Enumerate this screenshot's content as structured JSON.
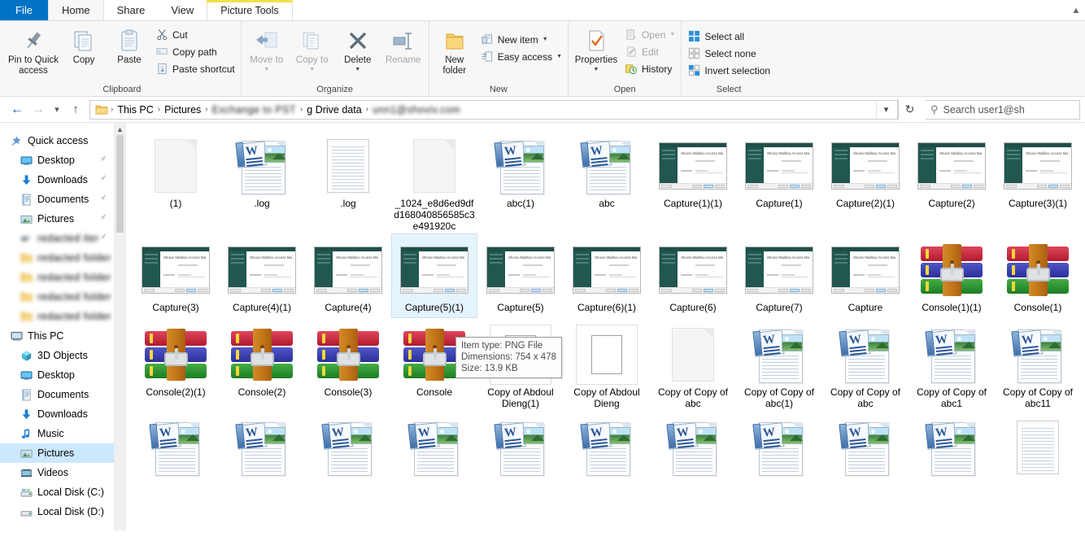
{
  "window": {
    "tabs": [
      {
        "label": "File",
        "kind": "file"
      },
      {
        "label": "Home",
        "kind": "active"
      },
      {
        "label": "Share",
        "kind": "normal"
      },
      {
        "label": "View",
        "kind": "normal"
      },
      {
        "label": "Picture Tools",
        "kind": "contextual"
      }
    ],
    "collapse_icon": "chevron-up"
  },
  "ribbon": {
    "groups": [
      {
        "title": "Clipboard",
        "large": [
          {
            "label": "Pin to Quick access",
            "icon": "pin-icon",
            "disabled": false
          },
          {
            "label": "Copy",
            "icon": "copy-icon",
            "disabled": false
          },
          {
            "label": "Paste",
            "icon": "paste-icon",
            "disabled": false
          }
        ],
        "small": [
          {
            "label": "Cut",
            "icon": "scissors-icon",
            "disabled": false
          },
          {
            "label": "Copy path",
            "icon": "copy-path-icon",
            "disabled": false
          },
          {
            "label": "Paste shortcut",
            "icon": "paste-shortcut-icon",
            "disabled": false
          }
        ]
      },
      {
        "title": "Organize",
        "large": [
          {
            "label": "Move to",
            "icon": "move-to-icon",
            "disabled": true,
            "caret": true
          },
          {
            "label": "Copy to",
            "icon": "copy-to-icon",
            "disabled": true,
            "caret": true
          },
          {
            "label": "Delete",
            "icon": "delete-x-icon",
            "disabled": false,
            "caret": true
          },
          {
            "label": "Rename",
            "icon": "rename-icon",
            "disabled": true
          }
        ]
      },
      {
        "title": "New",
        "large": [
          {
            "label": "New folder",
            "icon": "new-folder-icon",
            "disabled": false
          }
        ],
        "small": [
          {
            "label": "New item",
            "icon": "new-item-icon",
            "disabled": false,
            "caret": true
          },
          {
            "label": "Easy access",
            "icon": "easy-access-icon",
            "disabled": false,
            "caret": true
          }
        ]
      },
      {
        "title": "Open",
        "large": [
          {
            "label": "Properties",
            "icon": "properties-icon",
            "disabled": false,
            "caret": true
          }
        ],
        "small": [
          {
            "label": "Open",
            "icon": "open-icon",
            "disabled": true,
            "caret": true
          },
          {
            "label": "Edit",
            "icon": "edit-icon",
            "disabled": true
          },
          {
            "label": "History",
            "icon": "history-icon",
            "disabled": false
          }
        ]
      },
      {
        "title": "Select",
        "small": [
          {
            "label": "Select all",
            "icon": "select-all-icon",
            "disabled": false
          },
          {
            "label": "Select none",
            "icon": "select-none-icon",
            "disabled": false
          },
          {
            "label": "Invert selection",
            "icon": "invert-selection-icon",
            "disabled": false
          }
        ]
      }
    ]
  },
  "address": {
    "back_icon": "arrow-left-icon",
    "forward_icon": "arrow-right-icon",
    "recent_icon": "chevron-down-icon",
    "up_icon": "arrow-up-icon",
    "folder_icon": "folder-icon",
    "separator": "›",
    "crumbs": [
      {
        "label": "This PC",
        "blurred": false
      },
      {
        "label": "Pictures",
        "blurred": false
      },
      {
        "label": "Exchange to PST",
        "blurred": true
      },
      {
        "label": "g Drive data",
        "blurred": false
      },
      {
        "label": "unn1@shoviv.com",
        "blurred": true
      }
    ],
    "dropdown_icon": "chevron-down-icon",
    "refresh_icon": "refresh-icon"
  },
  "search": {
    "icon": "search-icon",
    "text": "Search user1@sh"
  },
  "sidebar": {
    "scroll_up_icon": "chevron-up-icon",
    "items": [
      {
        "label": "Quick access",
        "icon": "quick-access-star-icon",
        "level": 0,
        "pinned": false,
        "blurred": false,
        "selected": false
      },
      {
        "label": "Desktop",
        "icon": "desktop-icon",
        "level": 1,
        "pinned": true,
        "blurred": false,
        "selected": false
      },
      {
        "label": "Downloads",
        "icon": "downloads-icon",
        "level": 1,
        "pinned": true,
        "blurred": false,
        "selected": false
      },
      {
        "label": "Documents",
        "icon": "documents-icon",
        "level": 1,
        "pinned": true,
        "blurred": false,
        "selected": false
      },
      {
        "label": "Pictures",
        "icon": "pictures-icon",
        "level": 1,
        "pinned": true,
        "blurred": false,
        "selected": false
      },
      {
        "label": "redacted item",
        "icon": "generic-icon",
        "level": 1,
        "pinned": true,
        "blurred": true,
        "selected": false
      },
      {
        "label": "redacted folder one",
        "icon": "folder-icon",
        "level": 1,
        "pinned": false,
        "blurred": true,
        "selected": false
      },
      {
        "label": "redacted folder two",
        "icon": "folder-icon",
        "level": 1,
        "pinned": false,
        "blurred": true,
        "selected": false
      },
      {
        "label": "redacted folder three",
        "icon": "folder-icon",
        "level": 1,
        "pinned": false,
        "blurred": true,
        "selected": false
      },
      {
        "label": "redacted folder four",
        "icon": "folder-icon",
        "level": 1,
        "pinned": false,
        "blurred": true,
        "selected": false
      },
      {
        "label": "This PC",
        "icon": "this-pc-icon",
        "level": 0,
        "pinned": false,
        "blurred": false,
        "selected": false
      },
      {
        "label": "3D Objects",
        "icon": "3d-objects-icon",
        "level": 1,
        "pinned": false,
        "blurred": false,
        "selected": false
      },
      {
        "label": "Desktop",
        "icon": "desktop-icon",
        "level": 1,
        "pinned": false,
        "blurred": false,
        "selected": false
      },
      {
        "label": "Documents",
        "icon": "documents-icon",
        "level": 1,
        "pinned": false,
        "blurred": false,
        "selected": false
      },
      {
        "label": "Downloads",
        "icon": "downloads-icon",
        "level": 1,
        "pinned": false,
        "blurred": false,
        "selected": false
      },
      {
        "label": "Music",
        "icon": "music-icon",
        "level": 1,
        "pinned": false,
        "blurred": false,
        "selected": false
      },
      {
        "label": "Pictures",
        "icon": "pictures-icon",
        "level": 1,
        "pinned": false,
        "blurred": false,
        "selected": true
      },
      {
        "label": "Videos",
        "icon": "videos-icon",
        "level": 1,
        "pinned": false,
        "blurred": false,
        "selected": false
      },
      {
        "label": "Local Disk (C:)",
        "icon": "local-disk-c-icon",
        "level": 1,
        "pinned": false,
        "blurred": false,
        "selected": false
      },
      {
        "label": "Local Disk (D:)",
        "icon": "local-disk-d-icon",
        "level": 1,
        "pinned": false,
        "blurred": false,
        "selected": false
      }
    ]
  },
  "files": {
    "rows": [
      [
        {
          "name": "(1)",
          "icon": "blank-document-icon",
          "selected": false
        },
        {
          "name": ".log",
          "icon": "word-document-icon",
          "selected": false
        },
        {
          "name": ".log",
          "icon": "text-lines-document-icon",
          "selected": false
        },
        {
          "name": "_1024_e8d6ed9dfd168040856585c3e491920c",
          "icon": "blank-document-icon",
          "selected": false
        },
        {
          "name": "abc(1)",
          "icon": "word-document-icon",
          "selected": false
        },
        {
          "name": "abc",
          "icon": "word-document-icon",
          "selected": false
        },
        {
          "name": "Capture(1)(1)",
          "icon": "screenshot-thumbnail",
          "selected": false
        },
        {
          "name": "Capture(1)",
          "icon": "screenshot-thumbnail",
          "selected": false
        },
        {
          "name": "Capture(2)(1)",
          "icon": "screenshot-thumbnail",
          "selected": false
        },
        {
          "name": "Capture(2)",
          "icon": "screenshot-thumbnail",
          "selected": false
        },
        {
          "name": "Capture(3)(1)",
          "icon": "screenshot-thumbnail",
          "selected": false
        }
      ],
      [
        {
          "name": "Capture(3)",
          "icon": "screenshot-thumbnail",
          "selected": false
        },
        {
          "name": "Capture(4)(1)",
          "icon": "screenshot-thumbnail",
          "selected": false
        },
        {
          "name": "Capture(4)",
          "icon": "screenshot-thumbnail",
          "selected": false
        },
        {
          "name": "Capture(5)(1)",
          "icon": "screenshot-thumbnail",
          "selected": true
        },
        {
          "name": "Capture(5)",
          "icon": "screenshot-thumbnail",
          "selected": false
        },
        {
          "name": "Capture(6)(1)",
          "icon": "screenshot-thumbnail",
          "selected": false
        },
        {
          "name": "Capture(6)",
          "icon": "screenshot-thumbnail",
          "selected": false
        },
        {
          "name": "Capture(7)",
          "icon": "screenshot-thumbnail",
          "selected": false
        },
        {
          "name": "Capture",
          "icon": "screenshot-thumbnail",
          "selected": false
        },
        {
          "name": "Console(1)(1)",
          "icon": "rar-archive-icon",
          "selected": false
        },
        {
          "name": "Console(1)",
          "icon": "rar-archive-icon",
          "selected": false
        }
      ],
      [
        {
          "name": "Console(2)(1)",
          "icon": "rar-archive-icon",
          "selected": false
        },
        {
          "name": "Console(2)",
          "icon": "rar-archive-icon",
          "selected": false
        },
        {
          "name": "Console(3)",
          "icon": "rar-archive-icon",
          "selected": false
        },
        {
          "name": "Console",
          "icon": "rar-archive-icon",
          "selected": false
        },
        {
          "name": "Copy of Abdoul Dieng(1)",
          "icon": "framed-document-thumbnail",
          "selected": false
        },
        {
          "name": "Copy of Abdoul Dieng",
          "icon": "framed-document-thumbnail",
          "selected": false
        },
        {
          "name": "Copy of Copy of abc",
          "icon": "blank-document-icon",
          "selected": false
        },
        {
          "name": "Copy of Copy of abc(1)",
          "icon": "word-document-icon",
          "selected": false
        },
        {
          "name": "Copy of Copy of abc",
          "icon": "word-document-icon",
          "selected": false
        },
        {
          "name": "Copy of Copy of abc1",
          "icon": "word-document-icon",
          "selected": false
        },
        {
          "name": "Copy of Copy of abc11",
          "icon": "word-document-icon",
          "selected": false
        }
      ],
      [
        {
          "name": "",
          "icon": "word-document-icon",
          "selected": false
        },
        {
          "name": "",
          "icon": "word-document-icon",
          "selected": false
        },
        {
          "name": "",
          "icon": "word-document-icon",
          "selected": false
        },
        {
          "name": "",
          "icon": "word-document-icon",
          "selected": false
        },
        {
          "name": "",
          "icon": "word-document-icon",
          "selected": false
        },
        {
          "name": "",
          "icon": "word-document-icon",
          "selected": false
        },
        {
          "name": "",
          "icon": "word-document-icon",
          "selected": false
        },
        {
          "name": "",
          "icon": "word-document-icon",
          "selected": false
        },
        {
          "name": "",
          "icon": "word-document-icon",
          "selected": false
        },
        {
          "name": "",
          "icon": "word-document-icon",
          "selected": false
        },
        {
          "name": "",
          "icon": "text-lines-document-icon",
          "selected": false
        }
      ]
    ],
    "thumbnail_caption": "Shoviv Mailbox Access Manager"
  },
  "tooltip": {
    "line1": "Item type: PNG File",
    "line2": "Dimensions: 754 x 478",
    "line3": "Size: 13.9 KB"
  },
  "colors": {
    "file_tab_blue": "#0072c6",
    "contextual_accent": "#f2e04a",
    "selection_blue": "#cce8ff",
    "item_selection": "#e5f3fd"
  }
}
